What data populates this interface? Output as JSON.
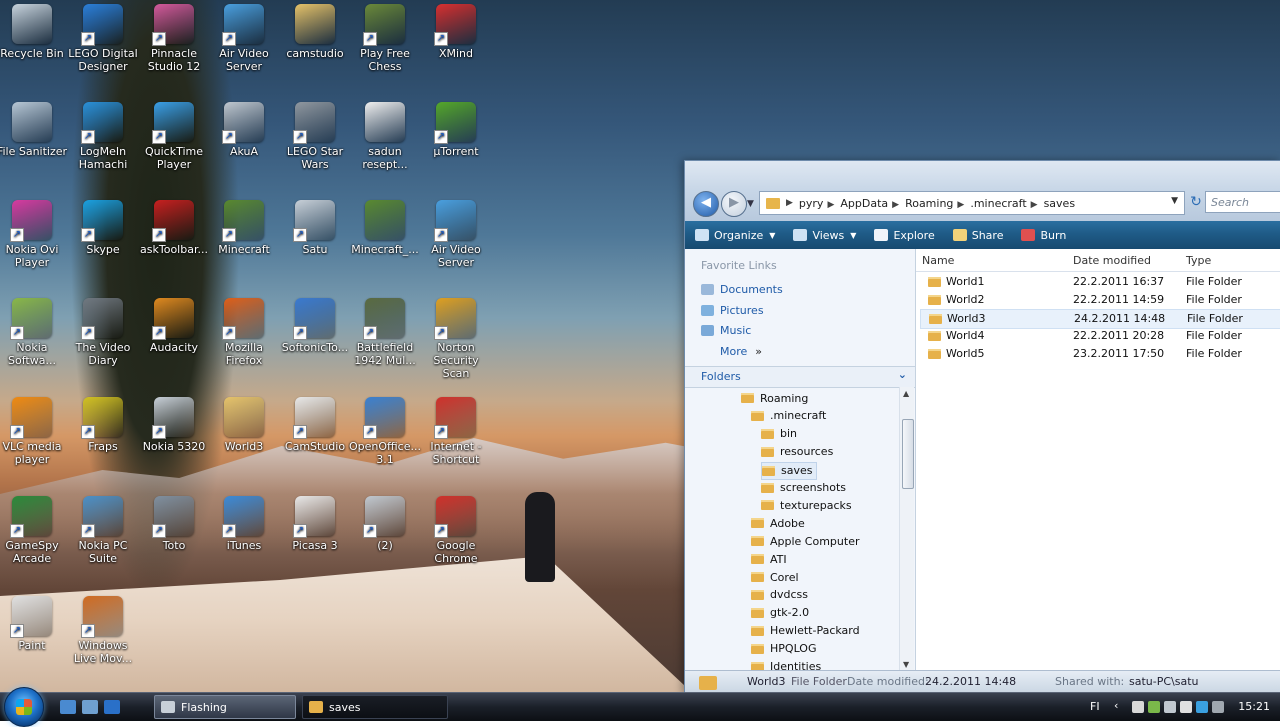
{
  "desktop": {
    "icons": [
      {
        "label": "Recycle Bin",
        "color": "#c8d4de",
        "shortcut": false
      },
      {
        "label": "LEGO Digital Designer",
        "color": "#2b7fd9",
        "shortcut": true
      },
      {
        "label": "Pinnacle Studio 12",
        "color": "#d45a9c",
        "shortcut": true
      },
      {
        "label": "Air Video Server",
        "color": "#4aa0e0",
        "shortcut": true
      },
      {
        "label": "camstudio",
        "color": "#e6c36a",
        "shortcut": false
      },
      {
        "label": "Play Free Chess",
        "color": "#6b8a3a",
        "shortcut": true
      },
      {
        "label": "XMind",
        "color": "#d83030",
        "shortcut": true
      },
      {
        "label": "File Sanitizer",
        "color": "#b8c8d6",
        "shortcut": false
      },
      {
        "label": "LogMeIn Hamachi",
        "color": "#2a90d8",
        "shortcut": true
      },
      {
        "label": "QuickTime Player",
        "color": "#3aa0e8",
        "shortcut": true
      },
      {
        "label": "AkuA",
        "color": "#c0c8d0",
        "shortcut": true
      },
      {
        "label": "LEGO Star Wars",
        "color": "#9098a0",
        "shortcut": true
      },
      {
        "label": "sadun resept...",
        "color": "#f0f0f0",
        "shortcut": false
      },
      {
        "label": "µTorrent",
        "color": "#55a82a",
        "shortcut": true
      },
      {
        "label": "Nokia Ovi Player",
        "color": "#d83aa0",
        "shortcut": true
      },
      {
        "label": "Skype",
        "color": "#1aa0e0",
        "shortcut": true
      },
      {
        "label": "askToolbar...",
        "color": "#c82020",
        "shortcut": true
      },
      {
        "label": "Minecraft",
        "color": "#5a8a30",
        "shortcut": true
      },
      {
        "label": "Satu",
        "color": "#c8d0d8",
        "shortcut": true
      },
      {
        "label": "Minecraft_...",
        "color": "#5a8a30",
        "shortcut": false
      },
      {
        "label": "Air Video Server",
        "color": "#4aa0e0",
        "shortcut": true
      },
      {
        "label": "Nokia Softwa...",
        "color": "#8ab848",
        "shortcut": true
      },
      {
        "label": "The Video Diary",
        "color": "#707880",
        "shortcut": true
      },
      {
        "label": "Audacity",
        "color": "#e08a20",
        "shortcut": true
      },
      {
        "label": "Mozilla Firefox",
        "color": "#e0601a",
        "shortcut": true
      },
      {
        "label": "SoftonicTo...",
        "color": "#3a7ad0",
        "shortcut": true
      },
      {
        "label": "Battlefield 1942 Mul...",
        "color": "#5a6a40",
        "shortcut": true
      },
      {
        "label": "Norton Security Scan",
        "color": "#e0a020",
        "shortcut": true
      },
      {
        "label": "VLC media player",
        "color": "#f08a10",
        "shortcut": true
      },
      {
        "label": "Fraps",
        "color": "#d0c020",
        "shortcut": true
      },
      {
        "label": "Nokia 5320",
        "color": "#c8d0d8",
        "shortcut": true
      },
      {
        "label": "World3",
        "color": "#e6c36a",
        "shortcut": false
      },
      {
        "label": "CamStudio",
        "color": "#e8e8e8",
        "shortcut": true
      },
      {
        "label": "OpenOffice... 3.1",
        "color": "#3a80d0",
        "shortcut": true
      },
      {
        "label": "Internet - Shortcut",
        "color": "#d0302a",
        "shortcut": true
      },
      {
        "label": "GameSpy Arcade",
        "color": "#2a8a3a",
        "shortcut": true
      },
      {
        "label": "Nokia PC Suite",
        "color": "#4a90c8",
        "shortcut": true
      },
      {
        "label": "Toto",
        "color": "#8090a0",
        "shortcut": true
      },
      {
        "label": "iTunes",
        "color": "#3a8ad8",
        "shortcut": true
      },
      {
        "label": "Picasa 3",
        "color": "#e8e8e8",
        "shortcut": true
      },
      {
        "label": "(2)",
        "color": "#c0c8d0",
        "shortcut": true
      },
      {
        "label": "Google Chrome",
        "color": "#d0302a",
        "shortcut": true
      },
      {
        "label": "Paint",
        "color": "#e0e0e0",
        "shortcut": true
      },
      {
        "label": "Windows Live Mov...",
        "color": "#d06a20",
        "shortcut": true
      }
    ]
  },
  "explorer": {
    "breadcrumb": [
      "pyry",
      "AppData",
      "Roaming",
      ".minecraft",
      "saves"
    ],
    "search_placeholder": "Search",
    "toolbar": [
      {
        "label": "Organize",
        "caret": true,
        "color": "#cfe2f4"
      },
      {
        "label": "Views",
        "caret": true,
        "color": "#cfe2f4"
      },
      {
        "label": "Explore",
        "caret": false,
        "color": "#f0f4fa"
      },
      {
        "label": "Share",
        "caret": false,
        "color": "#f2d27a"
      },
      {
        "label": "Burn",
        "caret": false,
        "color": "#e05050"
      }
    ],
    "favorite_links_heading": "Favorite Links",
    "favorites": [
      {
        "label": "Documents",
        "color": "#9ab8da"
      },
      {
        "label": "Pictures",
        "color": "#7fb1de"
      },
      {
        "label": "Music",
        "color": "#7aa9d8"
      }
    ],
    "more_label": "More",
    "more_glyph": "»",
    "folders_heading": "Folders",
    "folders_chevron": "⌄",
    "tree": [
      {
        "label": "Roaming",
        "indent": 56,
        "selected": false
      },
      {
        "label": ".minecraft",
        "indent": 66,
        "selected": false
      },
      {
        "label": "bin",
        "indent": 76,
        "selected": false
      },
      {
        "label": "resources",
        "indent": 76,
        "selected": false
      },
      {
        "label": "saves",
        "indent": 76,
        "selected": true
      },
      {
        "label": "screenshots",
        "indent": 76,
        "selected": false
      },
      {
        "label": "texturepacks",
        "indent": 76,
        "selected": false
      },
      {
        "label": "Adobe",
        "indent": 66,
        "selected": false
      },
      {
        "label": "Apple Computer",
        "indent": 66,
        "selected": false
      },
      {
        "label": "ATI",
        "indent": 66,
        "selected": false
      },
      {
        "label": "Corel",
        "indent": 66,
        "selected": false
      },
      {
        "label": "dvdcss",
        "indent": 66,
        "selected": false
      },
      {
        "label": "gtk-2.0",
        "indent": 66,
        "selected": false
      },
      {
        "label": "Hewlett-Packard",
        "indent": 66,
        "selected": false
      },
      {
        "label": "HPQLOG",
        "indent": 66,
        "selected": false
      },
      {
        "label": "Identities",
        "indent": 66,
        "selected": false
      }
    ],
    "columns": {
      "name": "Name",
      "date": "Date modified",
      "type": "Type"
    },
    "rows": [
      {
        "name": "World1",
        "date": "22.2.2011 16:37",
        "type": "File Folder",
        "selected": false
      },
      {
        "name": "World2",
        "date": "22.2.2011 14:59",
        "type": "File Folder",
        "selected": false
      },
      {
        "name": "World3",
        "date": "24.2.2011 14:48",
        "type": "File Folder",
        "selected": true
      },
      {
        "name": "World4",
        "date": "22.2.2011 20:28",
        "type": "File Folder",
        "selected": false
      },
      {
        "name": "World5",
        "date": "23.2.2011 17:50",
        "type": "File Folder",
        "selected": false
      }
    ],
    "status": {
      "name": "World3",
      "kind": "File Folder",
      "date_label": "Date modified:",
      "date": "24.2.2011 14:48",
      "shared_label": "Shared with:",
      "shared": "satu-PC\\satu"
    }
  },
  "taskbar": {
    "tasks": [
      {
        "label": "Flashing",
        "icon_color": "#c8d0d8"
      },
      {
        "label": "saves",
        "icon_color": "#e6b14a"
      }
    ],
    "quicklaunch": [
      "#4a8ad0",
      "#6fa0d0",
      "#2a70c8"
    ],
    "lang": "FI",
    "tray_colors": [
      "#d8d8d8",
      "#7ab84a",
      "#c0c8d0",
      "#e0e0e0",
      "#3aa0e0",
      "#a0a8b0"
    ],
    "clock": "15:21"
  }
}
